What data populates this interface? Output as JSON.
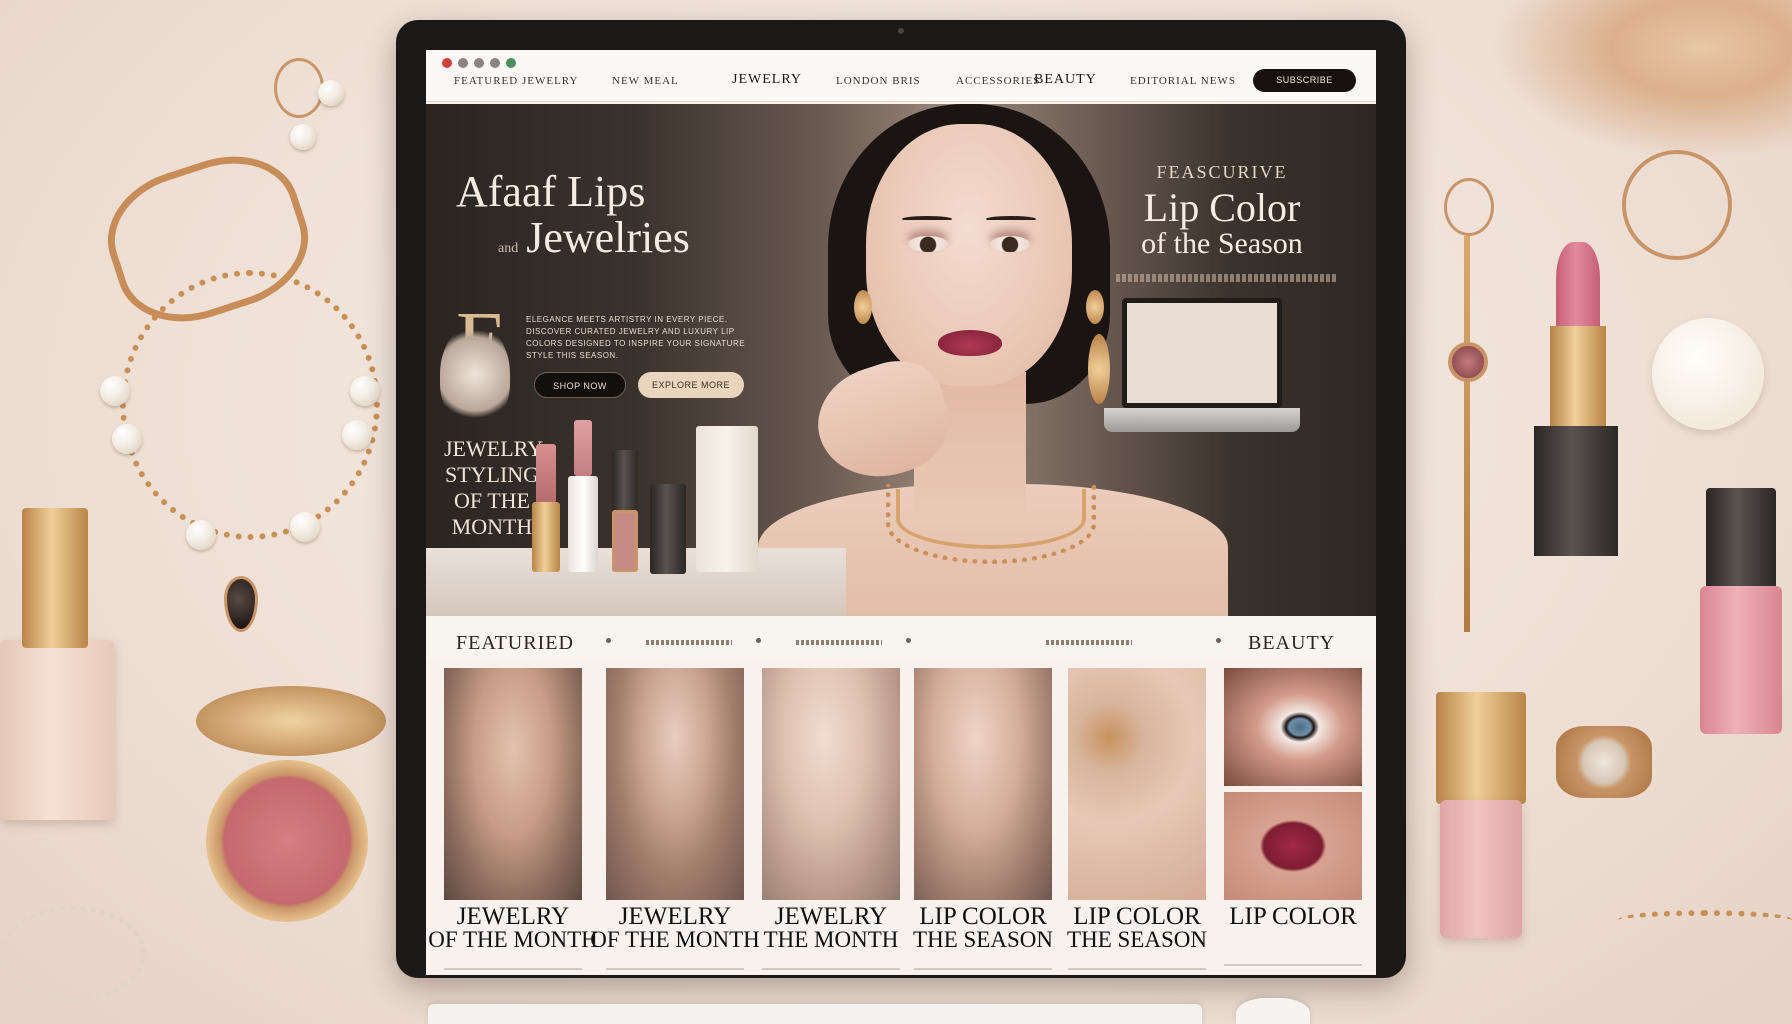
{
  "nav": {
    "items": [
      "FEATURED JEWELRY",
      "NEW MEAL",
      "JEWELRY",
      "LONDON BRIS",
      "ACCESSORIES",
      "BEAUTY",
      "EDITORIAL NEWS"
    ],
    "cta": "SUBSCRIBE"
  },
  "hero": {
    "title_line1": "Afaaf Lips",
    "title_and": "and",
    "title_line2": "Jewelries",
    "dropcap": "E",
    "body": "ELEGANCE MEETS ARTISTRY IN EVERY PIECE. DISCOVER CURATED JEWELRY AND LUXURY LIP COLORS DESIGNED TO INSPIRE YOUR SIGNATURE STYLE THIS SEASON.",
    "btn_primary": "SHOP NOW",
    "btn_secondary": "EXPLORE MORE",
    "styling_label": "JEWELRY STYLING OF THE MONTH",
    "feature_kicker": "FEASCURIVE",
    "feature_title": "Lip Color",
    "feature_subtitle": "of the Season"
  },
  "featured": {
    "left_label": "FEATURIED",
    "right_label": "BEAUTY",
    "mini_labels": [
      "MONTHLY PICKS",
      "EDITOR LOVES",
      "NEW ARRIVALS"
    ]
  },
  "cards": [
    {
      "line1": "JEWELRY",
      "line2": "OF THE MONTH"
    },
    {
      "line1": "JEWELRY",
      "line2": "OF THE MONTH"
    },
    {
      "line1": "JEWELRY",
      "line2": "THE MONTH"
    },
    {
      "line1": "LIP COLOR",
      "line2": "THE SEASON"
    },
    {
      "line1": "LIP COLOR",
      "line2": "THE SEASON"
    },
    {
      "line1": "LIP COLOR",
      "line2": ""
    }
  ],
  "colors": {
    "accent_gold": "#c99568",
    "lip": "#8a2238",
    "dark": "#1b1918"
  }
}
